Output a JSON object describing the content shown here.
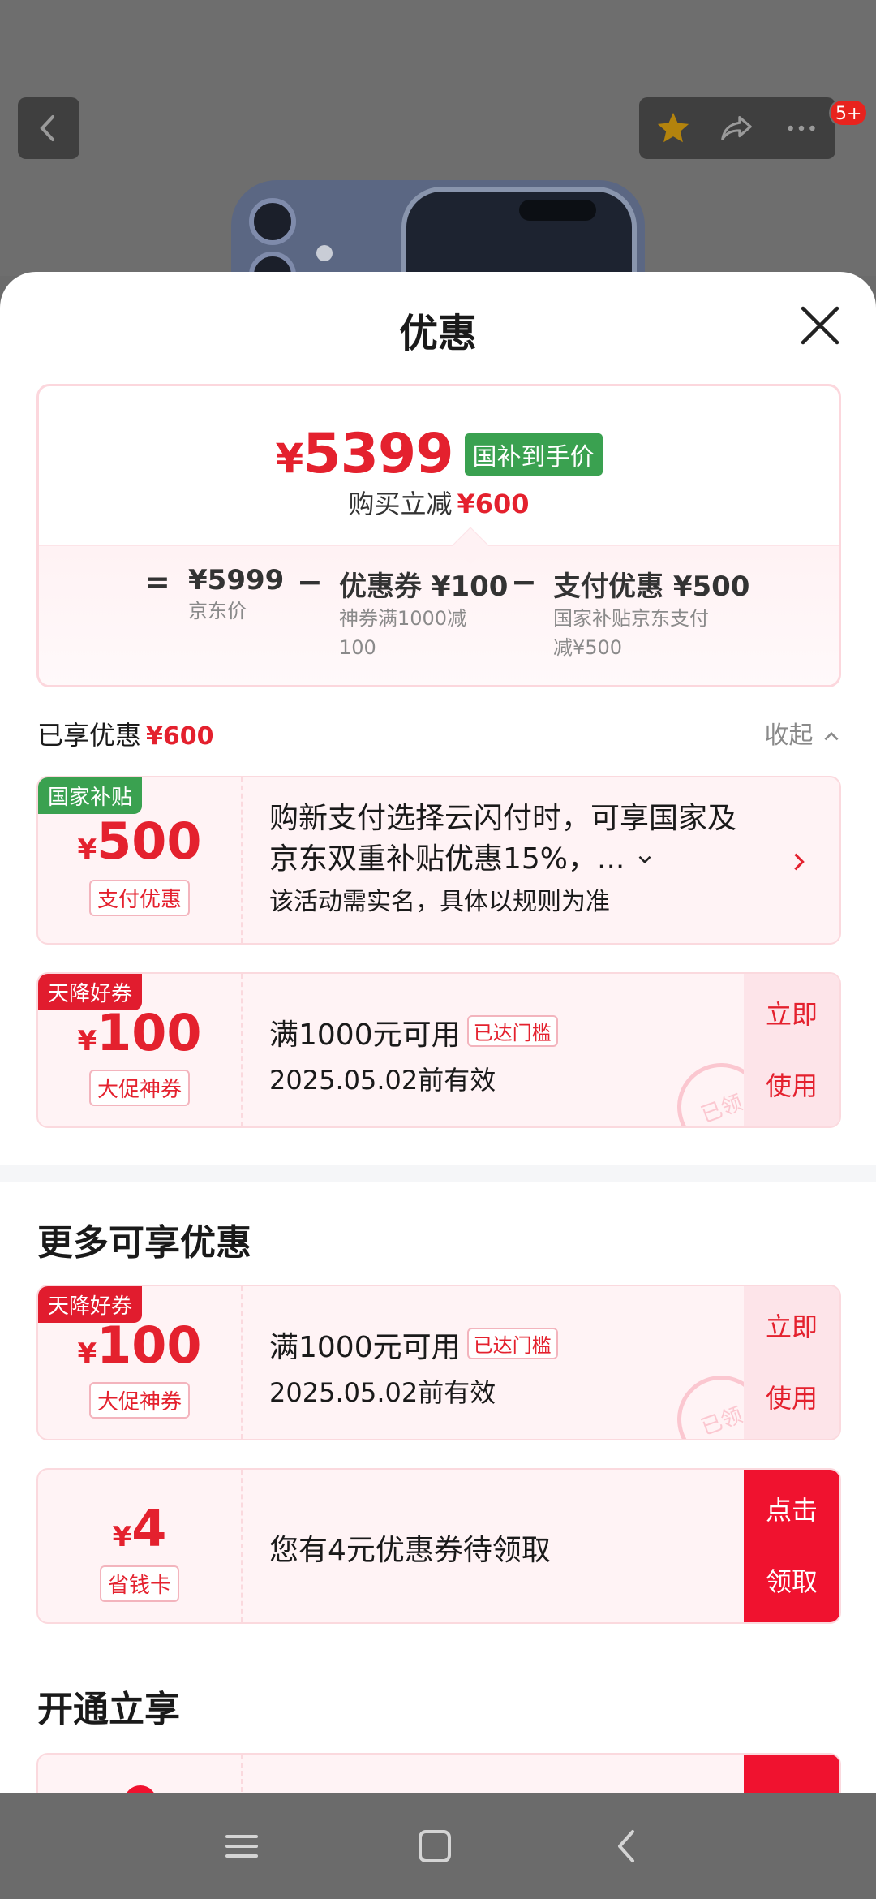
{
  "background": {
    "cart_badge": "5+"
  },
  "sheet": {
    "title": "优惠"
  },
  "summary": {
    "yen": "¥",
    "final_price": "5399",
    "final_tag": "国补到手价",
    "reduce_label": "购买立减",
    "reduce_value": "¥600",
    "equals": "=",
    "minus": "−",
    "items": [
      {
        "amount": "¥5999",
        "desc": "京东价"
      },
      {
        "amount": "优惠券 ¥100",
        "desc_line1": "神券满1000减",
        "desc_line2": "100"
      },
      {
        "amount": "支付优惠 ¥500",
        "desc_line1": "国家补贴京东支付",
        "desc_line2": "减¥500"
      }
    ]
  },
  "enjoyed": {
    "label": "已享优惠",
    "value": "¥600",
    "collapse": "收起"
  },
  "coupons": [
    {
      "tag": "国家补贴",
      "yen": "¥",
      "amount": "500",
      "type": "支付优惠",
      "line1": "购新支付选择云闪付时，可享国家及",
      "line2": "京东双重补贴优惠15%，...",
      "line3": "该活动需实名，具体以规则为准"
    },
    {
      "tag": "天降好券",
      "yen": "¥",
      "amount": "100",
      "type": "大促神券",
      "title": "满1000元可用",
      "threshold": "已达门槛",
      "valid": "2025.05.02前有效",
      "action_line1": "立即",
      "action_line2": "使用",
      "stamp": "已领"
    }
  ],
  "more": {
    "title": "更多可享优惠",
    "coupons": [
      {
        "tag": "天降好券",
        "yen": "¥",
        "amount": "100",
        "type": "大促神券",
        "title": "满1000元可用",
        "threshold": "已达门槛",
        "valid": "2025.05.02前有效",
        "action_line1": "立即",
        "action_line2": "使用",
        "stamp": "已领"
      },
      {
        "yen": "¥",
        "amount": "4",
        "type": "省钱卡",
        "title": "您有4元优惠券待领取",
        "action_line1": "点击",
        "action_line2": "领取"
      }
    ]
  },
  "open": {
    "title": "开通立享"
  },
  "colors": {
    "accent_red": "#e4212e",
    "national_green": "#3aa150",
    "nav_bar": "#6b6b6b"
  }
}
